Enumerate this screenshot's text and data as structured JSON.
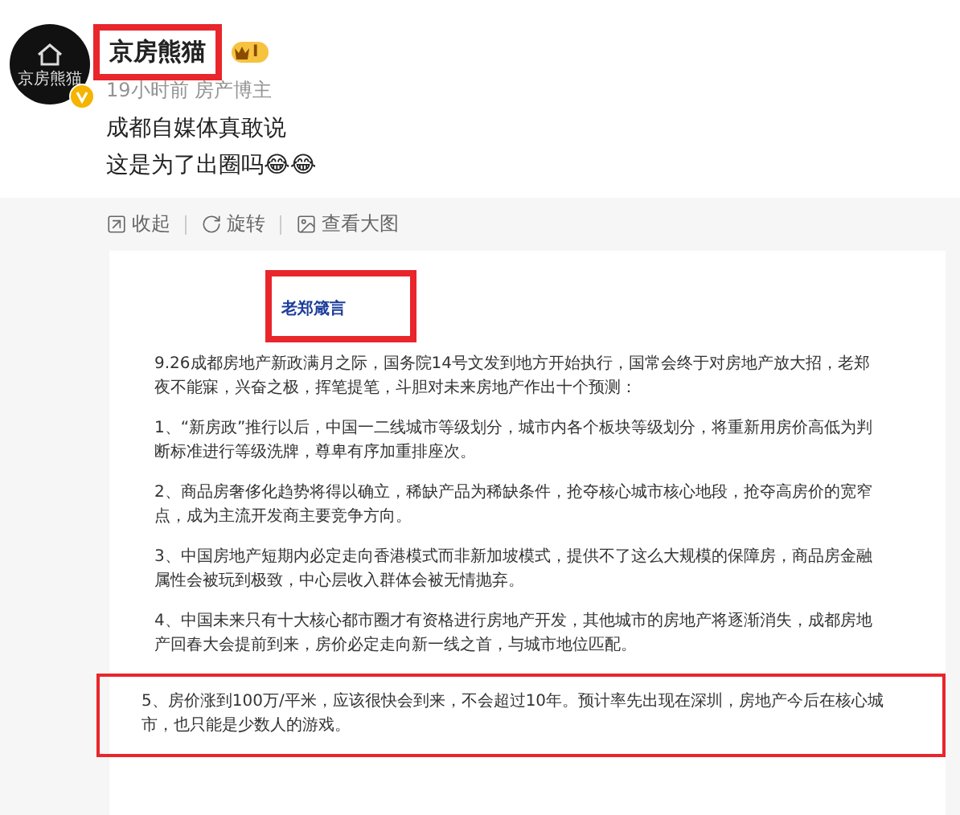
{
  "post": {
    "avatar": {
      "logo_text": "京房熊猫",
      "verified": true
    },
    "author": "京房熊猫",
    "level_badge": "I",
    "time": "19小时前",
    "tag": "房产博主",
    "lines": [
      "成都自媒体真敢说",
      "这是为了出圈吗😂😂"
    ],
    "highlighted_author": true
  },
  "image_actions": [
    {
      "kind": "collapse",
      "label": "收起"
    },
    {
      "kind": "rotate",
      "label": "旋转"
    },
    {
      "kind": "view",
      "label": "查看大图"
    }
  ],
  "document": {
    "title": "老郑箴言",
    "highlighted_title": true,
    "paragraphs": [
      {
        "text": "9.26成都房地产新政满月之际，国务院14号文发到地方开始执行，国常会终于对房地产放大招，老郑夜不能寐，兴奋之极，挥笔提笔，斗胆对未来房地产作出十个预测：",
        "highlighted": false
      },
      {
        "text": "1、“新房政”推行以后，中国一二线城市等级划分，城市内各个板块等级划分，将重新用房价高低为判断标准进行等级洗牌，尊卑有序加重排座次。",
        "highlighted": false
      },
      {
        "text": "2、商品房奢侈化趋势将得以确立，稀缺产品为稀缺条件，抢夺核心城市核心地段，抢夺高房价的宽窄点，成为主流开发商主要竞争方向。",
        "highlighted": false
      },
      {
        "text": "3、中国房地产短期内必定走向香港模式而非新加坡模式，提供不了这么大规模的保障房，商品房金融属性会被玩到极致，中心层收入群体会被无情抛弃。",
        "highlighted": false
      },
      {
        "text": "4、中国未来只有十大核心都市圈才有资格进行房地产开发，其他城市的房地产将逐渐消失，成都房地产回春大会提前到来，房价必定走向新一线之首，与城市地位匹配。",
        "highlighted": false
      },
      {
        "text": "5、房价涨到100万/平米，应该很快会到来，不会超过10年。预计率先出现在深圳，房地产今后在核心城市，也只能是少数人的游戏。",
        "highlighted": true
      }
    ]
  }
}
